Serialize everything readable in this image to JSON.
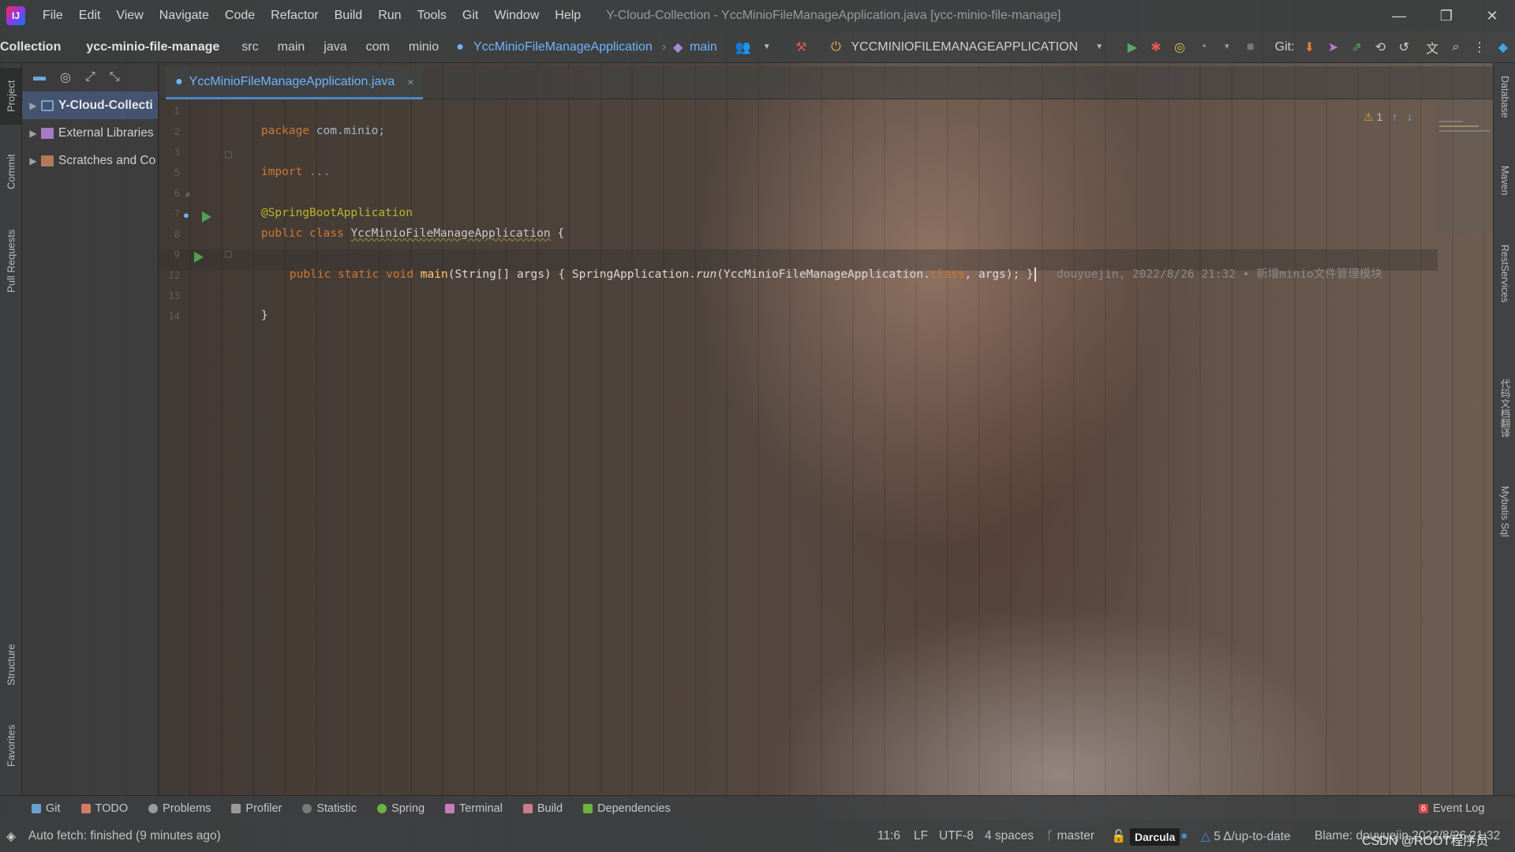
{
  "window": {
    "title": "Y-Cloud-Collection - YccMinioFileManageApplication.java [ycc-minio-file-manage]",
    "logo_text": "IJ",
    "minimize": "—",
    "restore": "❐",
    "close": "✕"
  },
  "menu": {
    "items": [
      {
        "label": "File",
        "u": "F"
      },
      {
        "label": "Edit",
        "u": "E"
      },
      {
        "label": "View",
        "u": "V"
      },
      {
        "label": "Navigate",
        "u": "N"
      },
      {
        "label": "Code",
        "u": "C"
      },
      {
        "label": "Refactor",
        "u": "R"
      },
      {
        "label": "Build",
        "u": "B"
      },
      {
        "label": "Run",
        "u": "R"
      },
      {
        "label": "Tools",
        "u": "T"
      },
      {
        "label": "Git",
        "u": "G"
      },
      {
        "label": "Window",
        "u": "W"
      },
      {
        "label": "Help",
        "u": "H"
      }
    ]
  },
  "breadcrumbs": {
    "project": "Collection",
    "module": "ycc-minio-file-manage",
    "path": [
      "src",
      "main",
      "java",
      "com",
      "minio"
    ],
    "class": "YccMinioFileManageApplication",
    "method": "main"
  },
  "toolbar": {
    "run_config": "YCCMINIOFILEMANAGEAPPLICATION",
    "git_label": "Git:"
  },
  "left_stripe": {
    "project": "Project",
    "commit": "Commit",
    "pull_requests": "Pull Requests",
    "structure": "Structure",
    "favorites": "Favorites"
  },
  "project_tree": {
    "items": [
      {
        "label": "Y-Cloud-Collecti",
        "selected": true
      },
      {
        "label": "External Libraries",
        "selected": false
      },
      {
        "label": "Scratches and Co",
        "selected": false
      }
    ]
  },
  "editor_tab": {
    "label": "YccMinioFileManageApplication.java",
    "close": "×"
  },
  "code": {
    "line_numbers": [
      "1",
      "2",
      "3",
      "5",
      "6",
      "7",
      "8",
      "9",
      "12",
      "13",
      "14"
    ],
    "package_kw": "package",
    "package_name": "com.minio;",
    "import_kw": "import",
    "import_fold": "...",
    "annotation": "@SpringBootApplication",
    "class_kw1": "public",
    "class_kw2": "class",
    "class_name": "YccMinioFileManageApplication",
    "class_open": "{",
    "main_kw": "public static void",
    "main_name": "main",
    "main_params": "(String[] args) { SpringApplication.",
    "main_run": "run",
    "main_arg": "(YccMinioFileManageApplication.",
    "main_class_kw": "class",
    "main_tail": ", args); }",
    "blame": "douyuejin, 2022/8/26 21:32 • 新增minio文件管理模块",
    "class_close": "}"
  },
  "inspection": {
    "warnings": "1",
    "warning_icon": "⚠",
    "up": "↑",
    "down": "↓"
  },
  "right_stripe": {
    "database": "Database",
    "maven": "Maven",
    "rest": "RestServices",
    "translate": "代码文档翻译",
    "mybatis": "Mybatis Sql"
  },
  "bottom_tools": [
    {
      "label": "Git",
      "icon": "git-branch-icon",
      "color": "#6a9fd4"
    },
    {
      "label": "TODO",
      "icon": "todo-list-icon",
      "color": "#d27c66"
    },
    {
      "label": "Problems",
      "icon": "info-icon",
      "color": "#9a9a9a"
    },
    {
      "label": "Profiler",
      "icon": "profiler-icon",
      "color": "#9a9a9a"
    },
    {
      "label": "Statistic",
      "icon": "statistic-icon",
      "color": "#7a7a7a"
    },
    {
      "label": "Spring",
      "icon": "spring-leaf-icon",
      "color": "#6db33f"
    },
    {
      "label": "Terminal",
      "icon": "terminal-icon",
      "color": "#c77dba"
    },
    {
      "label": "Build",
      "icon": "build-hammer-icon",
      "color": "#c47f8a"
    },
    {
      "label": "Dependencies",
      "icon": "dependencies-icon",
      "color": "#6db33f"
    }
  ],
  "event_log": {
    "count": "6",
    "label": "Event Log"
  },
  "status": {
    "message": "Auto fetch: finished (9 minutes ago)",
    "position": "11:6",
    "line_sep": "LF",
    "encoding": "UTF-8",
    "indent": "4 spaces",
    "branch": "master",
    "theme": "Darcula",
    "vcs": "5 Δ/up-to-date",
    "blame": "Blame: douyuejin 2022/8/26 21:32",
    "watermark": "CSDN @ROOT程序员"
  },
  "colors": {
    "accent": "#4a88c7",
    "run_green": "#59a869",
    "debug_red": "#e05555",
    "link_blue": "#6fb5ff"
  }
}
